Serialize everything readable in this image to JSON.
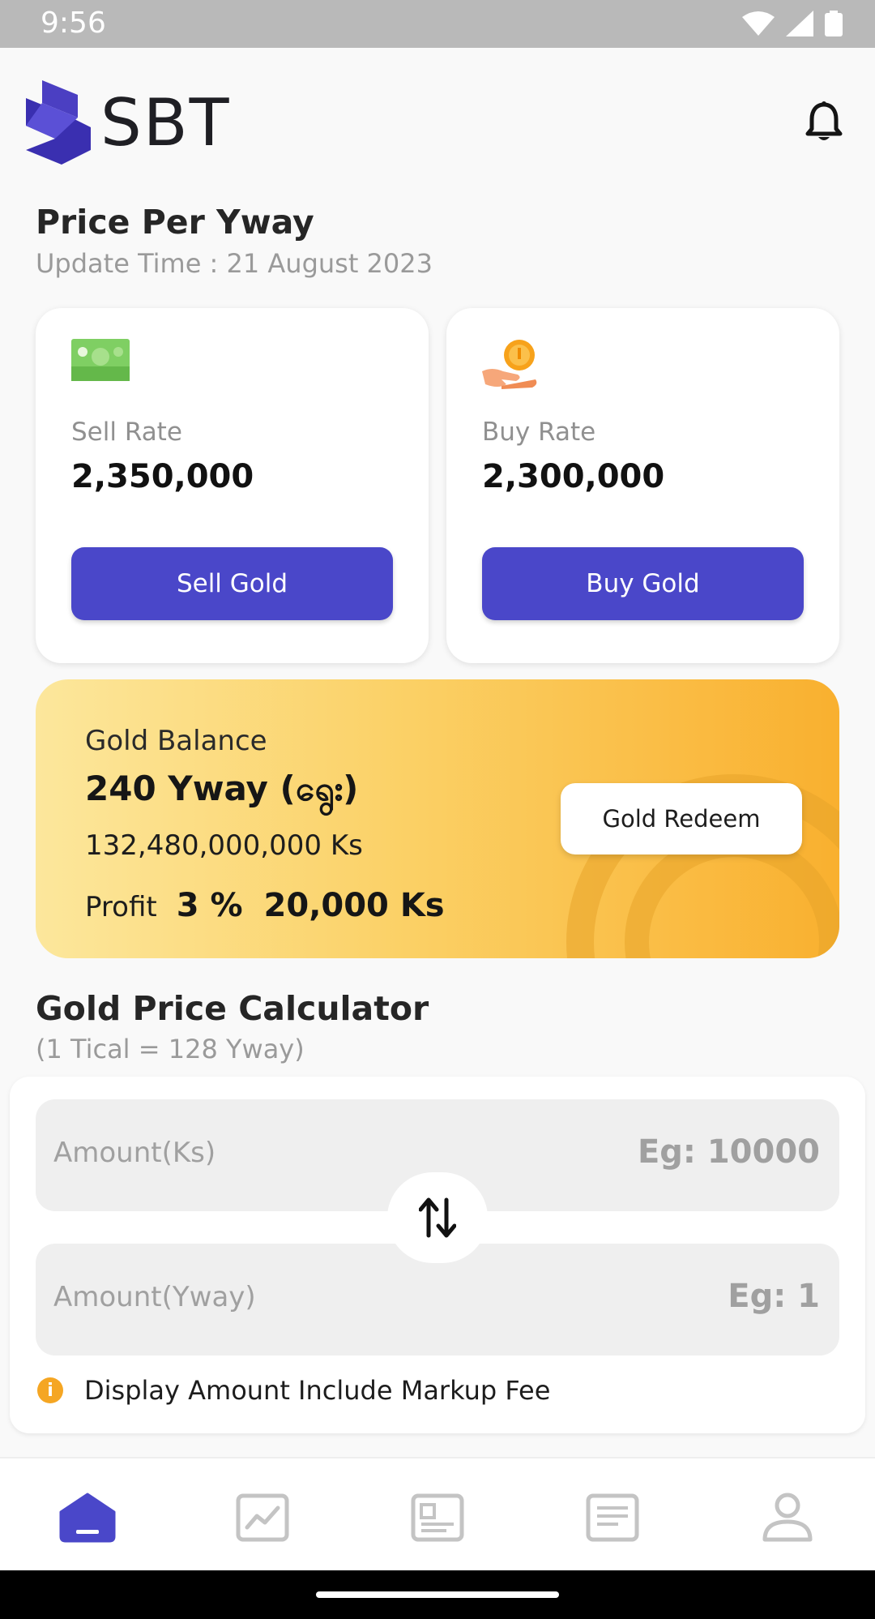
{
  "status_bar": {
    "time": "9:56"
  },
  "header": {
    "logo_text": "SBT"
  },
  "price": {
    "title": "Price Per Yway",
    "update_time": "Update Time : 21 August 2023"
  },
  "sell": {
    "label": "Sell Rate",
    "value": "2,350,000",
    "button": "Sell Gold",
    "icon": "cash-icon"
  },
  "buy": {
    "label": "Buy Rate",
    "value": "2,300,000",
    "button": "Buy Gold",
    "icon": "coin-hand-icon"
  },
  "gold_balance": {
    "label": "Gold Balance",
    "yway": "240 Yway (ရွေး)",
    "ks": "132,480,000,000 Ks",
    "profit_label": "Profit",
    "profit_pct": "3 %",
    "profit_ks": "20,000 Ks",
    "redeem_button": "Gold Redeem"
  },
  "calculator": {
    "title": "Gold Price Calculator",
    "subtitle": "(1 Tical = 128 Yway)",
    "ks_label": "Amount(Ks)",
    "ks_placeholder": "Eg: 10000",
    "yway_label": "Amount(Yway)",
    "yway_placeholder": "Eg: 1",
    "note": "Display Amount Include Markup Fee"
  },
  "nav": {
    "items": [
      {
        "name": "home",
        "active": true
      },
      {
        "name": "chart",
        "active": false
      },
      {
        "name": "news",
        "active": false
      },
      {
        "name": "history",
        "active": false
      },
      {
        "name": "profile",
        "active": false
      }
    ]
  },
  "colors": {
    "accent": "#4a47c9",
    "gold_start": "#fce79c",
    "gold_end": "#f9b02f",
    "nav_inactive": "#c4c4c4"
  }
}
